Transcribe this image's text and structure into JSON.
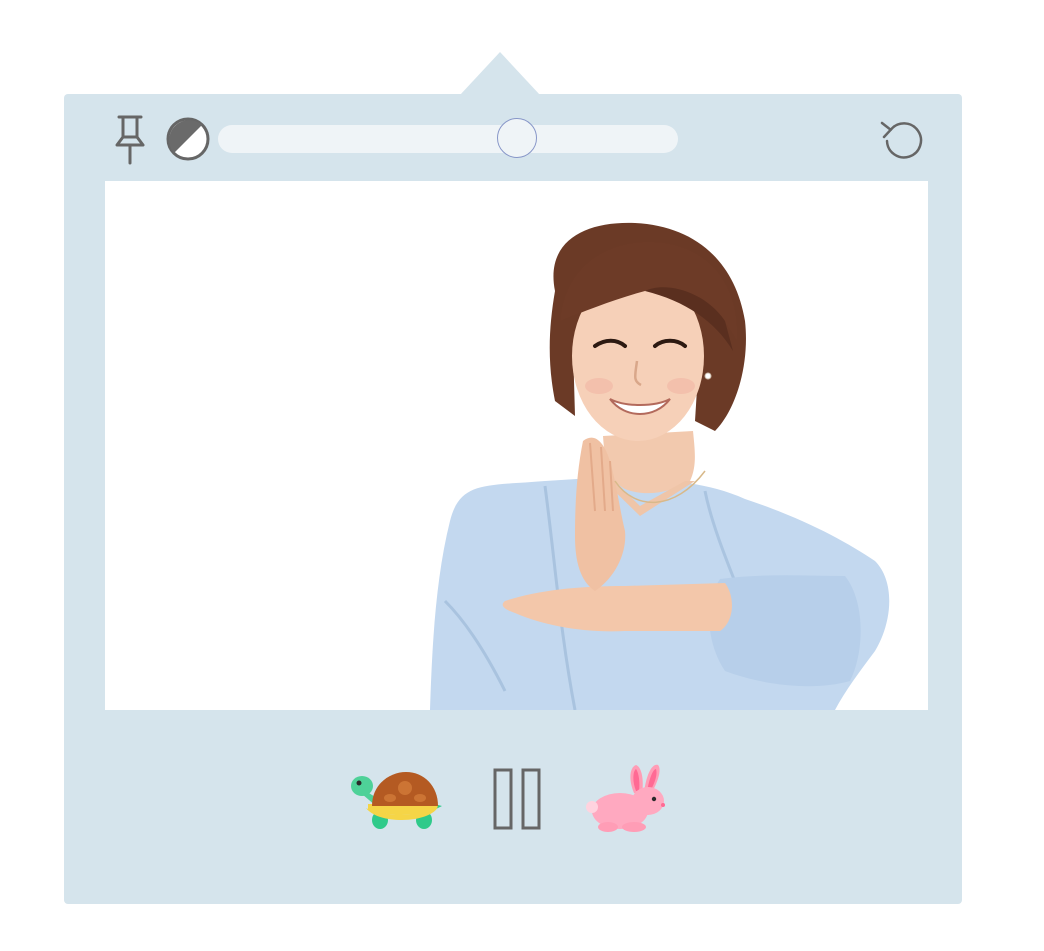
{
  "player": {
    "toolbar": {
      "pin_icon": "pin-icon",
      "contrast_icon": "contrast-icon",
      "reset_icon": "reset-icon"
    },
    "size_slider": {
      "value": 0.65
    },
    "video": {
      "subject": "signer-video"
    },
    "controls": {
      "slow_icon": "turtle-icon",
      "pause_icon": "pause-icon",
      "fast_icon": "rabbit-icon"
    }
  },
  "colors": {
    "panel": "#d5e4ec",
    "track": "#eff4f7",
    "thumb_border": "#8796c8",
    "icon_gray": "#666666"
  }
}
